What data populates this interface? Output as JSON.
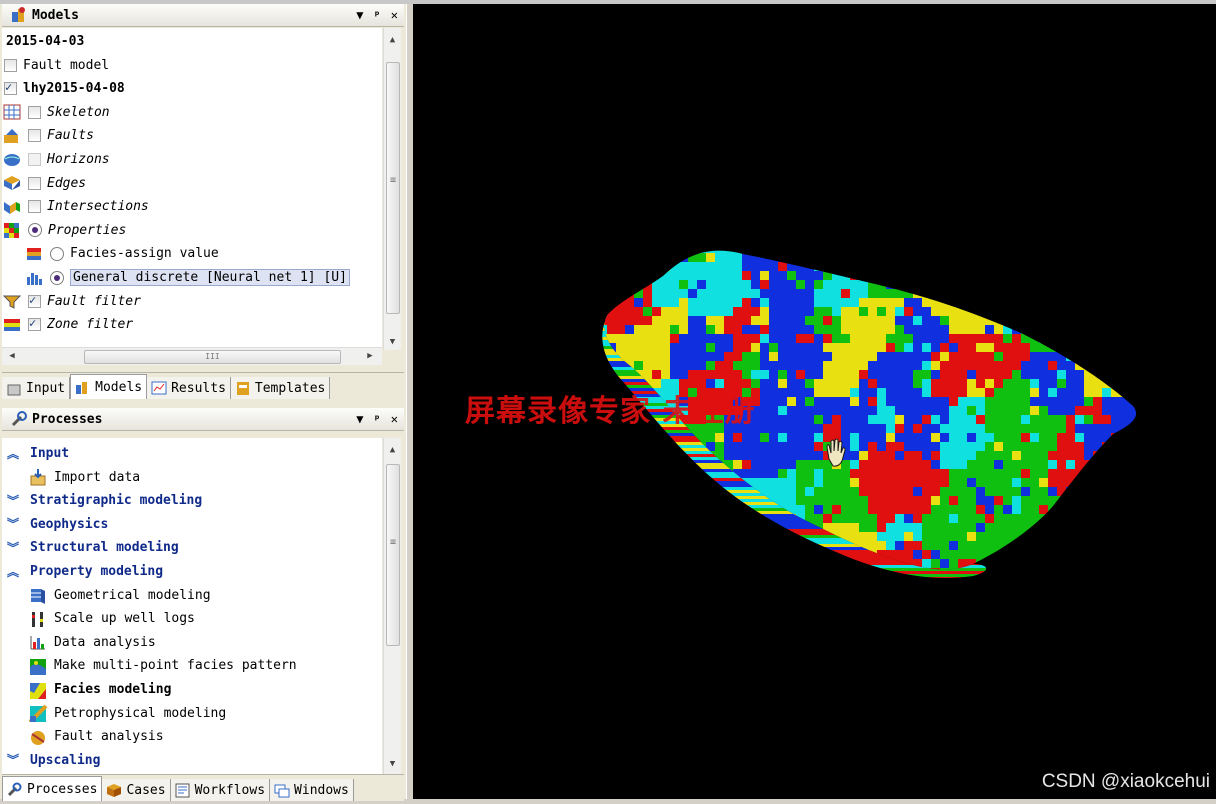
{
  "models_panel": {
    "title": "Models",
    "pin_glyph": "▼",
    "dock_glyph": "ᵖ",
    "close_glyph": "✕",
    "tree": [
      {
        "label": "2015-04-03",
        "style": "bold",
        "indent": 0,
        "control": "none",
        "icon": "none"
      },
      {
        "label": "Fault model",
        "style": "normal",
        "indent": 0,
        "control": "checkbox-off",
        "icon": "none"
      },
      {
        "label": "lhy2015-04-08",
        "style": "bold",
        "indent": 0,
        "control": "checkbox-on",
        "icon": "none"
      },
      {
        "label": "Skeleton",
        "style": "italic",
        "indent": 1,
        "control": "checkbox-off",
        "icon": "skeleton-icon"
      },
      {
        "label": "Faults",
        "style": "italic",
        "indent": 1,
        "control": "checkbox-off",
        "icon": "faults-icon"
      },
      {
        "label": "Horizons",
        "style": "italic",
        "indent": 1,
        "control": "checkbox-disabled",
        "icon": "horizons-icon"
      },
      {
        "label": "Edges",
        "style": "italic",
        "indent": 1,
        "control": "checkbox-off",
        "icon": "edges-icon"
      },
      {
        "label": "Intersections",
        "style": "italic",
        "indent": 1,
        "control": "checkbox-off",
        "icon": "intersections-icon"
      },
      {
        "label": "Properties",
        "style": "italic",
        "indent": 1,
        "control": "radio-on",
        "icon": "properties-icon"
      },
      {
        "label": "Facies-assign value",
        "style": "normal",
        "indent": 2,
        "control": "radio-off",
        "icon": "facies-icon"
      },
      {
        "label": "General discrete [Neural net 1] [U]",
        "style": "selected",
        "indent": 2,
        "control": "radio-on",
        "icon": "discrete-icon"
      },
      {
        "label": "Fault filter",
        "style": "italic",
        "indent": 1,
        "control": "checkbox-on",
        "icon": "fault-filter-icon"
      },
      {
        "label": "Zone filter",
        "style": "italic",
        "indent": 1,
        "control": "checkbox-on",
        "icon": "zone-filter-icon"
      }
    ],
    "hscroll_grip": "III",
    "vscroll_grip": "≡"
  },
  "model_tabs": [
    {
      "label": "Input",
      "active": false,
      "icon": "input-tab-icon"
    },
    {
      "label": "Models",
      "active": true,
      "icon": "models-tab-icon"
    },
    {
      "label": "Results",
      "active": false,
      "icon": "results-tab-icon"
    },
    {
      "label": "Templates",
      "active": false,
      "icon": "templates-tab-icon"
    }
  ],
  "processes_panel": {
    "title": "Processes",
    "pin_glyph": "▼",
    "dock_glyph": "ᵖ",
    "close_glyph": "✕",
    "entries": [
      {
        "type": "group",
        "label": "Input",
        "expanded": true
      },
      {
        "type": "item",
        "label": "Import data",
        "bold": false,
        "icon": "import-data-icon"
      },
      {
        "type": "group",
        "label": "Stratigraphic modeling",
        "expanded": false
      },
      {
        "type": "group",
        "label": "Geophysics",
        "expanded": false
      },
      {
        "type": "group",
        "label": "Structural modeling",
        "expanded": false
      },
      {
        "type": "group",
        "label": "Property modeling",
        "expanded": true
      },
      {
        "type": "item",
        "label": "Geometrical modeling",
        "bold": false,
        "icon": "geometrical-modeling-icon"
      },
      {
        "type": "item",
        "label": "Scale up well logs",
        "bold": false,
        "icon": "scale-up-icon"
      },
      {
        "type": "item",
        "label": "Data analysis",
        "bold": false,
        "icon": "data-analysis-icon"
      },
      {
        "type": "item",
        "label": "Make multi-point facies pattern",
        "bold": false,
        "icon": "facies-pattern-icon"
      },
      {
        "type": "item",
        "label": "Facies modeling",
        "bold": true,
        "icon": "facies-modeling-icon"
      },
      {
        "type": "item",
        "label": "Petrophysical modeling",
        "bold": false,
        "icon": "petrophysical-icon"
      },
      {
        "type": "item",
        "label": "Fault analysis",
        "bold": false,
        "icon": "fault-analysis-icon"
      },
      {
        "type": "group",
        "label": "Upscaling",
        "expanded": false
      }
    ],
    "vscroll_grip": "≡"
  },
  "process_tabs": [
    {
      "label": "Processes",
      "active": true,
      "icon": "processes-tab-icon"
    },
    {
      "label": "Cases",
      "active": false,
      "icon": "cases-tab-icon"
    },
    {
      "label": "Workflows",
      "active": false,
      "icon": "workflows-tab-icon"
    },
    {
      "label": "Windows",
      "active": false,
      "icon": "windows-tab-icon"
    }
  ],
  "viewport": {
    "overlay_text": "屏幕录像专家 未注册",
    "watermark": "CSDN @xiaokcehui",
    "facies_colors": [
      "#1030e0",
      "#10c010",
      "#e8e010",
      "#e01010",
      "#10e0e0",
      "#0a60a0"
    ]
  }
}
